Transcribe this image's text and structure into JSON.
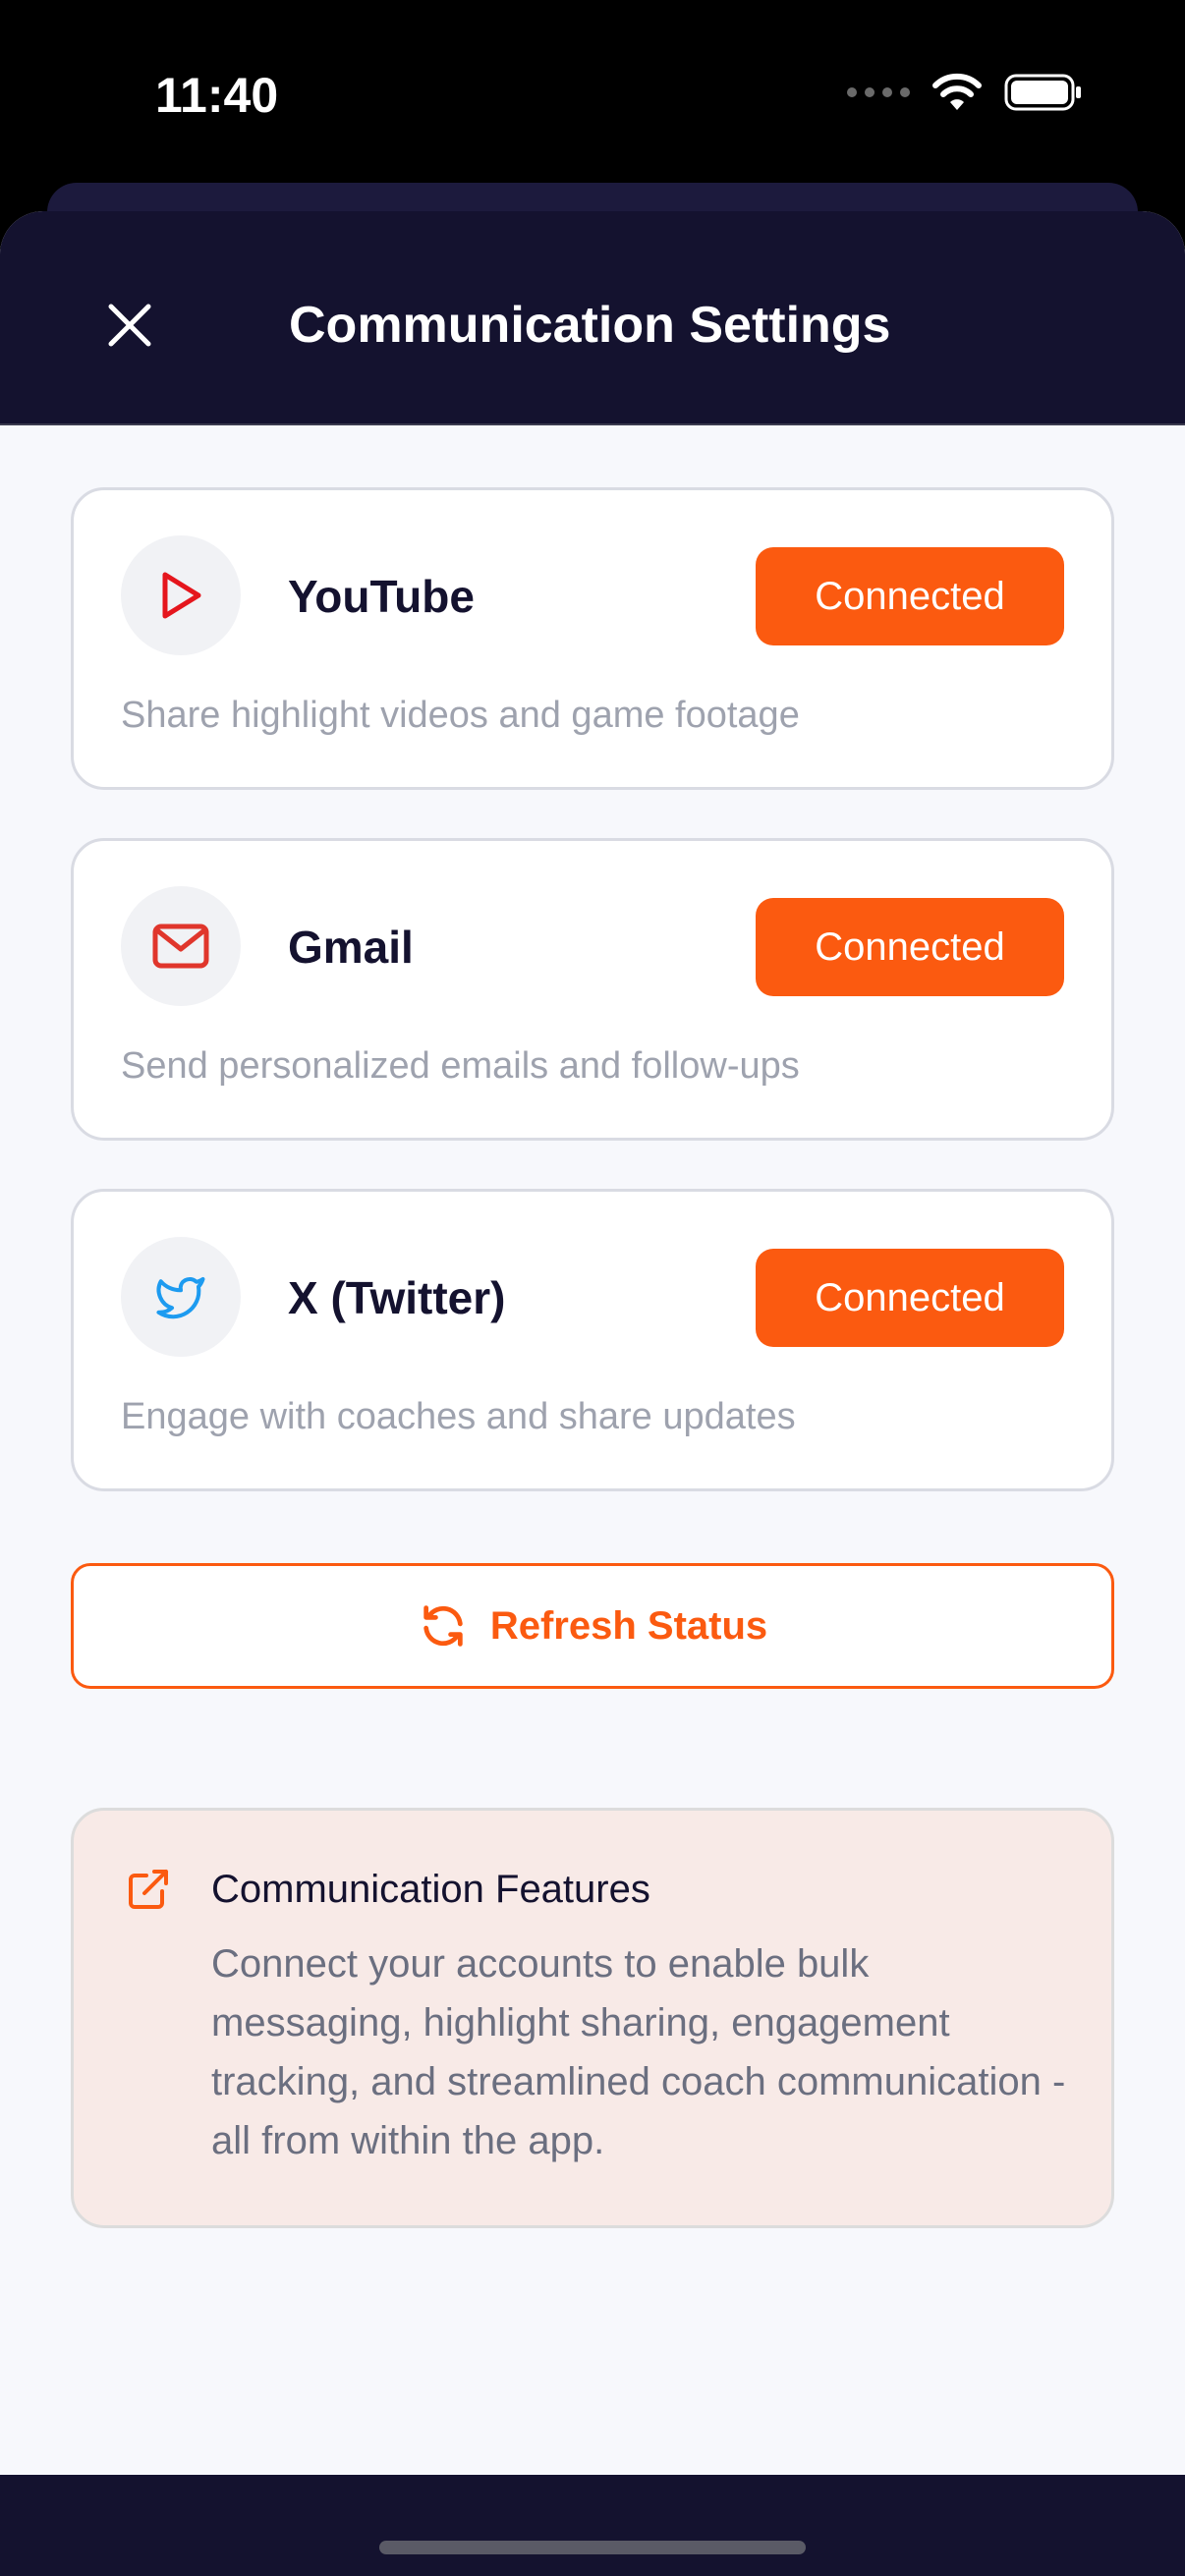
{
  "status_bar": {
    "time": "11:40"
  },
  "header": {
    "title": "Communication Settings"
  },
  "integrations": [
    {
      "name": "YouTube",
      "status": "Connected",
      "description": "Share highlight videos and game footage",
      "icon": "play-icon",
      "icon_color": "#e5161d"
    },
    {
      "name": "Gmail",
      "status": "Connected",
      "description": "Send personalized emails and follow-ups",
      "icon": "mail-icon",
      "icon_color": "#e0362c"
    },
    {
      "name": "X (Twitter)",
      "status": "Connected",
      "description": "Engage with coaches and share updates",
      "icon": "twitter-bird-icon",
      "icon_color": "#1d9bf0"
    }
  ],
  "refresh": {
    "label": "Refresh Status"
  },
  "info": {
    "title": "Communication Features",
    "text": "Connect your accounts to enable bulk messaging, highlight sharing, engagement tracking, and streamlined coach communication - all from within the app."
  },
  "colors": {
    "accent": "#fb5a10",
    "header_bg": "#14122f",
    "page_bg": "#f7f8fc",
    "info_bg": "#f8eae7"
  }
}
